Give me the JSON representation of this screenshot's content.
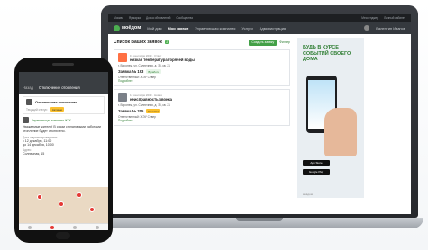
{
  "laptop": {
    "os_bar": {
      "items": [
        "Москва",
        "Ярмарка",
        "Доска объявлений",
        "Сообщества"
      ],
      "right": [
        "Мессенджер",
        "Личный кабинет"
      ]
    },
    "site": {
      "logo": "моёдом",
      "nav": [
        "Мой дом",
        "Мои заявки",
        "Управляющая компания",
        "Услуги",
        "Администрация"
      ],
      "user": "Валентин Иванов"
    },
    "main": {
      "heading": "Список Ваших заявок",
      "count": "2",
      "create_button": "Создать заявку",
      "filter_link": "Фильтр",
      "cards": [
        {
          "meta": "15 сентября 2019 · Ответ",
          "title": "низкая температура горячей воды",
          "address": "г. Воронеж, ул. Солнечная, д. 15, кв. 21",
          "number": "Заявка № 193",
          "status": "В работе",
          "assigned": "Ответственный: ЖЭУ Север",
          "details": "Подробнее"
        },
        {
          "meta": "12 сентября 2019 · Новая",
          "title": "неисправность звонка",
          "address": "г. Воронеж, ул. Солнечная, д. 15, кв. 21",
          "number": "Заявка № 205",
          "status": "Принята",
          "assigned": "Ответственный: ЖЭУ Север",
          "details": "Подробнее"
        }
      ]
    },
    "ad": {
      "headline": "БУДЬ В КУРСЕ СОБЫТИЙ СВОЕГО ДОМА",
      "app_store": "App Store",
      "google_play": "Google Play",
      "footer": "моёдом"
    }
  },
  "phone": {
    "back": "Назад",
    "title": "Отключение отопления",
    "category": "Отключение отопления",
    "status_label": "Текущий статус:",
    "status": "Активно",
    "company": "Управляющая компания ЖКХ",
    "message": "Уважаемые жители! В связи с плановыми работами отопление будет отключено.",
    "period_label": "Дата и время проведения:",
    "period_from": "с 12 декабря, 11:00",
    "period_to": "до 14 декабря, 10:00",
    "address_label": "Адрес:",
    "address": "Солнечная, 15"
  }
}
